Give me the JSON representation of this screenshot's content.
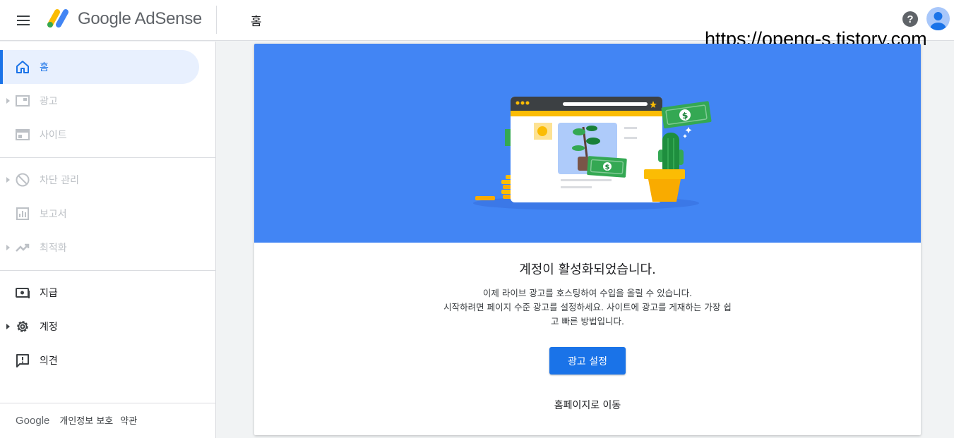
{
  "header": {
    "brand": "Google AdSense",
    "page_title": "홈",
    "help_symbol": "?",
    "watermark": "https://openg-s.tistory.com"
  },
  "sidebar": {
    "items": [
      {
        "label": "홈",
        "icon": "home-icon",
        "state": "active"
      },
      {
        "label": "광고",
        "icon": "ads-icon",
        "state": "disabled"
      },
      {
        "label": "사이트",
        "icon": "sites-icon",
        "state": "disabled"
      },
      {
        "label": "차단 관리",
        "icon": "block-icon",
        "state": "disabled"
      },
      {
        "label": "보고서",
        "icon": "reports-icon",
        "state": "disabled"
      },
      {
        "label": "최적화",
        "icon": "optimize-icon",
        "state": "disabled"
      },
      {
        "label": "지급",
        "icon": "payments-icon",
        "state": "enabled"
      },
      {
        "label": "계정",
        "icon": "settings-icon",
        "state": "enabled"
      },
      {
        "label": "의견",
        "icon": "feedback-icon",
        "state": "enabled"
      }
    ],
    "footer": {
      "google": "Google",
      "privacy": "개인정보 보호",
      "terms": "약관"
    }
  },
  "card": {
    "heading": "계정이 활성화되었습니다.",
    "body_line1": "이제 라이브 광고를 호스팅하여 수입을 올릴 수 있습니다.",
    "body_line2": "시작하려면 페이지 수준 광고를 설정하세요. 사이트에 광고를 게재하는 가장 쉽",
    "body_line3": "고 빠른 방법입니다.",
    "primary_button": "광고 설정",
    "secondary_link": "홈페이지로 이동",
    "currency_symbol": "$"
  },
  "colors": {
    "accent": "#1a73e8",
    "hero_bg": "#4285f4",
    "active_bg": "#e8f0fe",
    "disabled": "#bdc1c6"
  }
}
